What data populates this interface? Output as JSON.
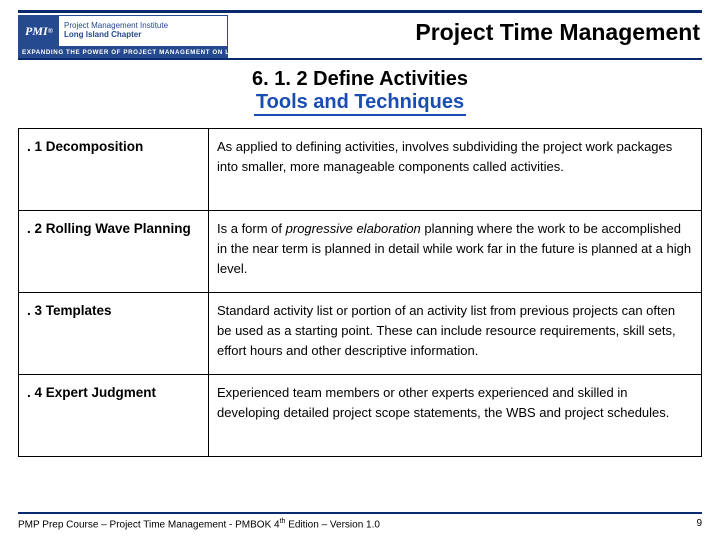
{
  "header": {
    "logo_abbrev": "PMI",
    "logo_reg": "®",
    "logo_line1": "Project Management Institute",
    "logo_line2": "Long Island Chapter",
    "logo_tagline": "EXPANDING THE POWER OF PROJECT MANAGEMENT ON LONG ISLAND",
    "title": "Project Time Management"
  },
  "subtitle": {
    "line1": "6. 1. 2 Define Activities",
    "line2": "Tools and Techniques"
  },
  "rows": [
    {
      "idx": ". 1  Decomposition",
      "desc_pre": "As applied to defining activities, involves subdividing the project  work packages into smaller, more manageable components called activities.",
      "desc_em": "",
      "desc_post": ""
    },
    {
      "idx": ". 2 Rolling Wave Planning",
      "desc_pre": "Is a form of ",
      "desc_em": "progressive elaboration",
      "desc_post": " planning where the work to be accomplished in the near term is planned in detail while work far in the future is planned at a high level."
    },
    {
      "idx": ". 3  Templates",
      "desc_pre": "Standard activity list or portion of an activity list from previous projects can often be used as a starting point.  These can include resource requirements, skill sets, effort hours and other descriptive information.",
      "desc_em": "",
      "desc_post": ""
    },
    {
      "idx": ". 4  Expert Judgment",
      "desc_pre": "Experienced team members or other experts experienced and skilled in developing detailed project scope statements, the WBS and project schedules.",
      "desc_em": "",
      "desc_post": ""
    }
  ],
  "footer": {
    "left_pre": "PMP Prep Course – Project Time Management - PMBOK 4",
    "left_sup": "th",
    "left_post": " Edition – Version 1.0",
    "page": "9"
  }
}
